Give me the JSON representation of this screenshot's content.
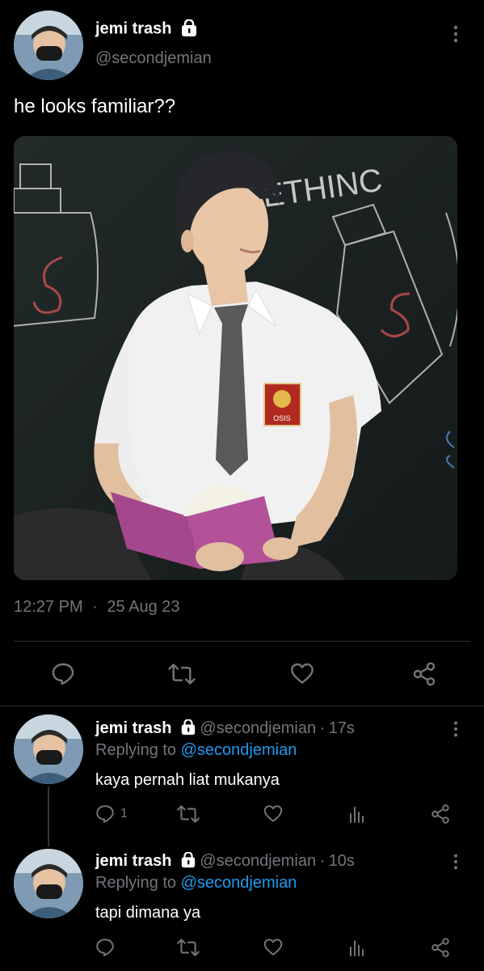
{
  "tweet": {
    "author_name": "jemi trash",
    "author_handle": "@secondjemian",
    "text": "he looks familiar??",
    "time": "12:27 PM",
    "date": "25 Aug 23",
    "separator": "·",
    "more_icon": "more-vertical-icon",
    "action_icons": [
      "reply-icon",
      "retweet-icon",
      "like-icon",
      "share-icon"
    ]
  },
  "replies": [
    {
      "author_name": "jemi trash",
      "author_handle": "@secondjemian",
      "age": "17s",
      "separator": "·",
      "replying_label": "Replying to",
      "replying_to": "@secondjemian",
      "text": "kaya pernah liat mukanya",
      "reply_count": "1"
    },
    {
      "author_name": "jemi trash",
      "author_handle": "@secondjemian",
      "age": "10s",
      "separator": "·",
      "replying_label": "Replying to",
      "replying_to": "@secondjemian",
      "text": "tapi dimana ya",
      "reply_count": ""
    }
  ],
  "media_caption": {
    "chalk_text": "ETHINC",
    "chalk_letter": "S",
    "badge_text": "OSIS"
  },
  "colors": {
    "background": "#000000",
    "muted": "#71767b",
    "accent": "#1d9bf0",
    "divider": "#2f3336"
  }
}
